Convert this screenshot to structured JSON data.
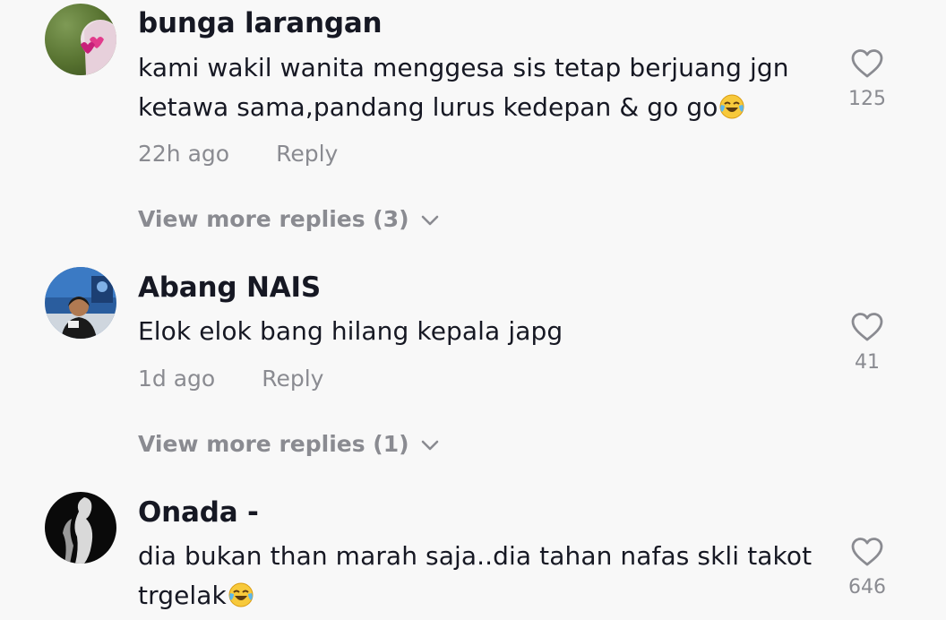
{
  "comments": [
    {
      "author": "bunga larangan",
      "text": "kami wakil wanita menggesa sis tetap berjuang jgn ketawa sama,pandang lurus kedepan & go go",
      "emoji": "😂",
      "time": "22h ago",
      "reply_label": "Reply",
      "likes": "125",
      "view_more": "View more replies (3)"
    },
    {
      "author": "Abang NAIS",
      "text": "Elok elok bang hilang kepala japg",
      "time": "1d ago",
      "reply_label": "Reply",
      "likes": "41",
      "view_more": "View more replies (1)"
    },
    {
      "author": "Onada -",
      "text": "dia bukan than marah saja..dia tahan nafas skli takot trgelak",
      "emoji": "😂",
      "likes": "646"
    }
  ],
  "icons": {
    "like": "heart-outline-icon",
    "expand": "chevron-down-icon",
    "emoji": "face-with-tears-of-joy"
  },
  "colors": {
    "background": "#f8f8f8",
    "text_primary": "#161823",
    "text_secondary": "#8a8b91"
  }
}
